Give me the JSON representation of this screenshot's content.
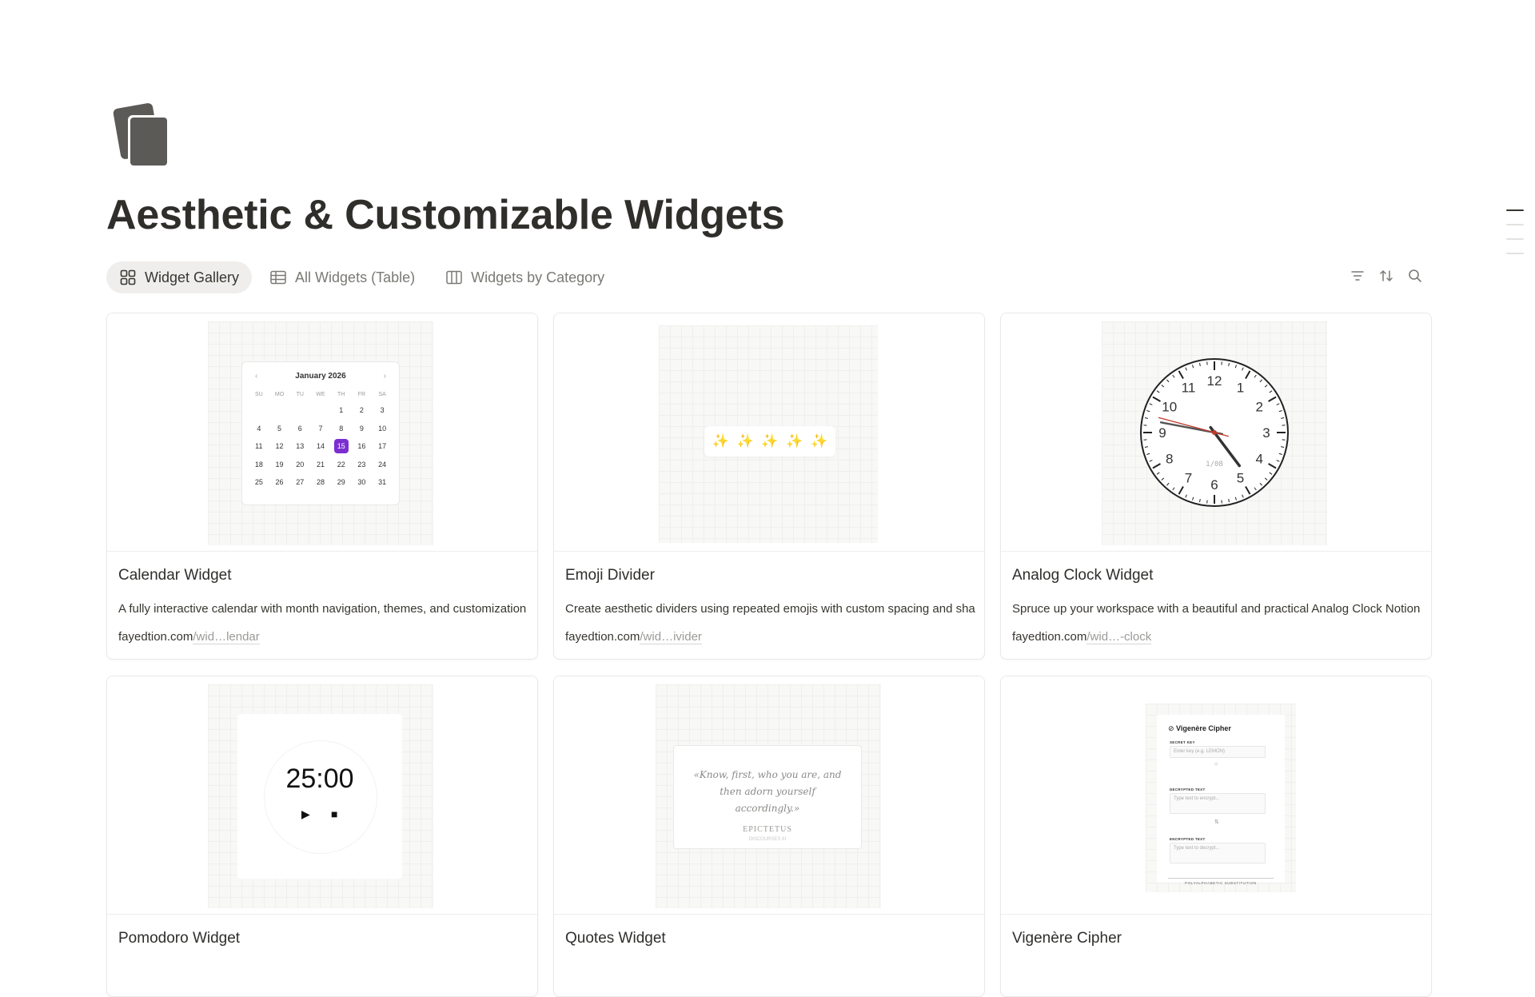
{
  "page": {
    "title": "Aesthetic & Customizable Widgets",
    "icon": "stacked-cards-icon"
  },
  "tabs": [
    {
      "label": "Widget Gallery",
      "icon": "gallery-grid-icon",
      "active": true
    },
    {
      "label": "All Widgets (Table)",
      "icon": "table-icon",
      "active": false
    },
    {
      "label": "Widgets by Category",
      "icon": "board-columns-icon",
      "active": false
    }
  ],
  "toolbar": {
    "filter_icon": "filter-icon",
    "sort_icon": "sort-icon",
    "search_icon": "search-icon"
  },
  "cards": [
    {
      "title": "Calendar Widget",
      "description": "A fully interactive calendar with month navigation, themes, and customization",
      "link_domain": "fayedtion.com",
      "link_path": "/wid…lendar",
      "preview": {
        "month": "January 2026",
        "prev": "‹",
        "next": "›",
        "weekdays": [
          "SU",
          "MO",
          "TU",
          "WE",
          "TH",
          "FR",
          "SA"
        ],
        "days": [
          "",
          "",
          "",
          "",
          "1",
          "2",
          "3",
          "4",
          "5",
          "6",
          "7",
          "8",
          "9",
          "10",
          "11",
          "12",
          "13",
          "14",
          "15",
          "16",
          "17",
          "18",
          "19",
          "20",
          "21",
          "22",
          "23",
          "24",
          "25",
          "26",
          "27",
          "28",
          "29",
          "30",
          "31"
        ],
        "selected": "15",
        "accent": "#7b2fd1"
      }
    },
    {
      "title": "Emoji Divider",
      "description": "Create aesthetic dividers using repeated emojis with custom spacing and sha",
      "link_domain": "fayedtion.com",
      "link_path": "/wid…ivider",
      "preview": {
        "emojis": [
          "✨",
          "✨",
          "✨",
          "✨",
          "✨"
        ]
      }
    },
    {
      "title": "Analog Clock Widget",
      "description": "Spruce up your workspace with a beautiful and practical Analog Clock Notion",
      "link_domain": "fayedtion.com",
      "link_path": "/wid…-clock",
      "preview": {
        "numbers": [
          "12",
          "1",
          "2",
          "3",
          "4",
          "5",
          "6",
          "7",
          "8",
          "9",
          "10",
          "11"
        ],
        "date": "1/08",
        "hour": 4,
        "minute": 46,
        "second": 47.5,
        "second_hand_color": "#c0392b"
      }
    },
    {
      "title": "Pomodoro Widget",
      "preview": {
        "time": "25:00",
        "play": "▶",
        "stop": "■"
      }
    },
    {
      "title": "Quotes Widget",
      "preview": {
        "quote": "«Know, first, who you are, and then adorn yourself accordingly.»",
        "author": "EPICTETUS",
        "sub": "DISCOURSES III"
      }
    },
    {
      "title": "Vigenère Cipher",
      "preview": {
        "heading": "Vigenère Cipher",
        "secret_label": "SECRET KEY",
        "secret_placeholder": "Enter key (e.g. LEMON)",
        "decrypted_label": "DECRYPTED TEXT",
        "decrypted_placeholder": "Type text to encrypt...",
        "encrypted_label": "ENCRYPTED TEXT",
        "encrypted_placeholder": "Type text to decrypt...",
        "footer": "POLYALPHABETIC SUBSTITUTION"
      }
    }
  ]
}
